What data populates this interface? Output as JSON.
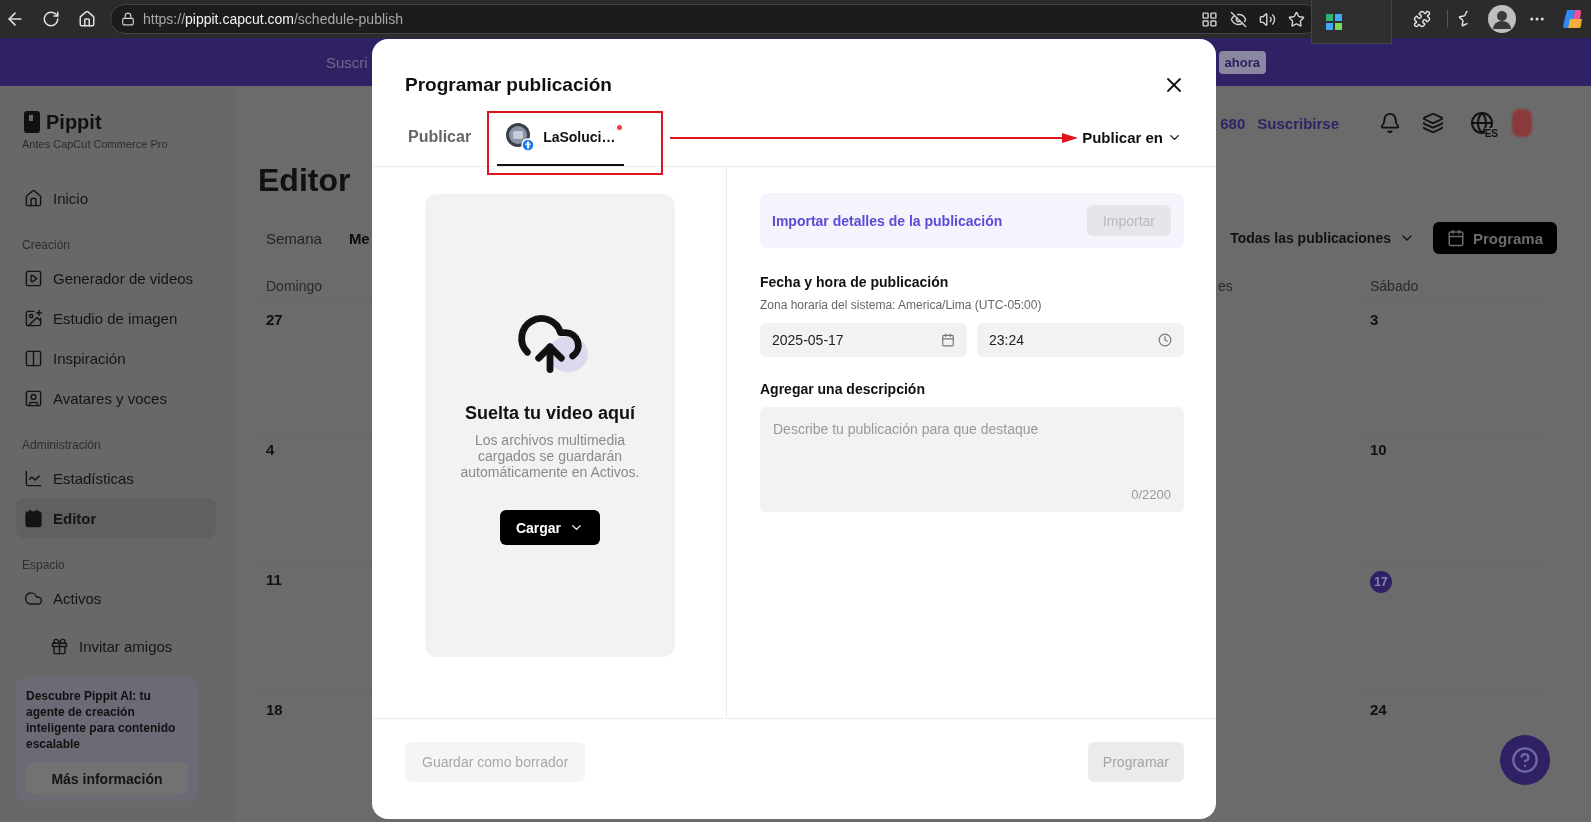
{
  "browser": {
    "url_scheme": "https://",
    "url_host": "pippit.capcut.com",
    "url_path": "/schedule-publish"
  },
  "banner": {
    "text": "Suscri",
    "button": "ahora"
  },
  "brand": {
    "name": "Pippit",
    "subtitle": "Antes CapCut Commerce Pro"
  },
  "sidebar": {
    "items": [
      {
        "kind": "item",
        "label": "Inicio",
        "selected": false
      },
      {
        "kind": "section",
        "label": "Creación"
      },
      {
        "kind": "item",
        "label": "Generador de videos",
        "selected": false
      },
      {
        "kind": "item",
        "label": "Estudio de imagen",
        "selected": false
      },
      {
        "kind": "item",
        "label": "Inspiración",
        "selected": false
      },
      {
        "kind": "item",
        "label": "Avatares y voces",
        "selected": false
      },
      {
        "kind": "section",
        "label": "Administración"
      },
      {
        "kind": "item",
        "label": "Estadísticas",
        "selected": false
      },
      {
        "kind": "item",
        "label": "Editor",
        "selected": true
      },
      {
        "kind": "section",
        "label": "Espacio"
      },
      {
        "kind": "item",
        "label": "Activos",
        "selected": false
      },
      {
        "kind": "invite",
        "label": "Invitar amigos",
        "selected": false
      }
    ],
    "promo": {
      "text": "Descubre Pippit AI: tu agente de creación inteligente para contenido escalable",
      "button": "Más información"
    }
  },
  "header": {
    "credits": "680",
    "subscribe": "Suscribirse",
    "language": "ES"
  },
  "page": {
    "title": "Editor",
    "views": [
      {
        "label": "Semana",
        "selected": false
      },
      {
        "label": "Me",
        "selected": true
      }
    ],
    "filter": "Todas las publicaciones",
    "schedule_button": "Programa"
  },
  "calendar": {
    "columns": [
      {
        "header": "Domingo",
        "days": [
          {
            "day": "27",
            "selected": false
          },
          {
            "day": "4",
            "selected": false
          },
          {
            "day": "11",
            "selected": false
          },
          {
            "day": "18",
            "selected": false
          }
        ]
      },
      {
        "header": "es"
      },
      {
        "header": "Sábado",
        "days": [
          {
            "day": "3",
            "selected": false
          },
          {
            "day": "10",
            "selected": false
          },
          {
            "day": "17",
            "selected": true
          },
          {
            "day": "24",
            "selected": false
          }
        ]
      }
    ]
  },
  "dialog": {
    "title": "Programar publicación",
    "tabs": [
      {
        "kind": "text",
        "label": "Publicar",
        "selected": false
      },
      {
        "kind": "account",
        "label": "LaSoluci…",
        "selected": true,
        "unread": true,
        "highlighted": true
      }
    ],
    "publish_to": "Publicar en",
    "upload": {
      "title": "Suelta tu video aquí",
      "description": "Los archivos multimedia cargados se guardarán automáticamente en Activos.",
      "button": "Cargar"
    },
    "import": {
      "text": "Importar detalles de la publicación",
      "button": "Importar",
      "disabled": true
    },
    "datetime": {
      "label": "Fecha y hora de publicación",
      "timezone": "Zona horaria del sistema: America/Lima (UTC-05:00)",
      "date": "2025-05-17",
      "time": "23:24"
    },
    "description": {
      "label": "Agregar una descripción",
      "placeholder": "Describe tu publicación para que destaque",
      "counter": "0/2200"
    },
    "footer": [
      {
        "label": "Guardar como borrador",
        "disabled": true
      },
      {
        "label": "Programar",
        "disabled": true
      }
    ]
  }
}
